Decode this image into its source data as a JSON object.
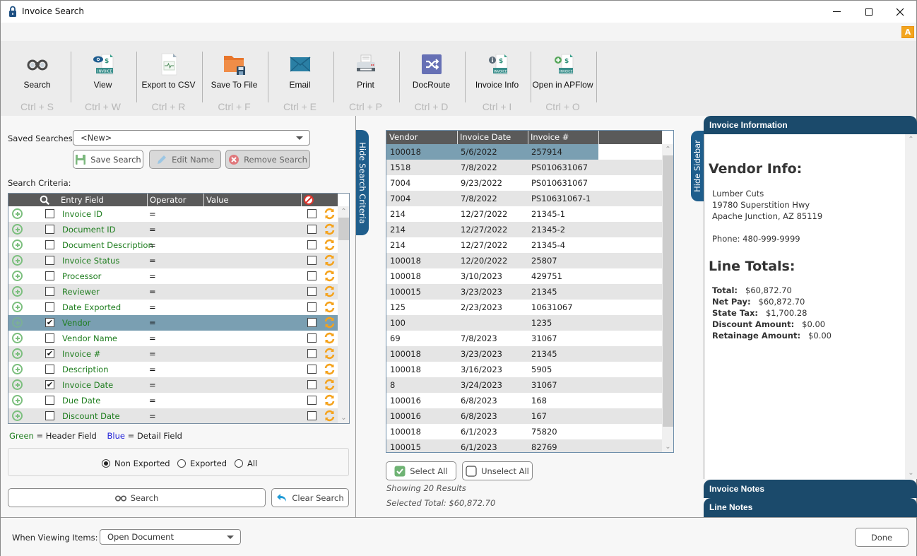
{
  "window": {
    "title": "Invoice Search",
    "badge_letter": "A"
  },
  "toolbar": {
    "buttons": [
      {
        "id": "search",
        "label": "Search",
        "shortcut": "Ctrl + S",
        "icon": "binoculars-icon"
      },
      {
        "id": "view",
        "label": "View",
        "shortcut": "Ctrl + W",
        "icon": "view-invoice-icon"
      },
      {
        "id": "export",
        "label": "Export to CSV",
        "shortcut": "Ctrl + R",
        "icon": "csv-file-icon"
      },
      {
        "id": "save",
        "label": "Save To File",
        "shortcut": "Ctrl + F",
        "icon": "folder-save-icon"
      },
      {
        "id": "email",
        "label": "Email",
        "shortcut": "Ctrl + E",
        "icon": "envelope-icon"
      },
      {
        "id": "print",
        "label": "Print",
        "shortcut": "Ctrl + P",
        "icon": "printer-icon"
      },
      {
        "id": "docroute",
        "label": "DocRoute",
        "shortcut": "Ctrl + D",
        "icon": "shuffle-icon"
      },
      {
        "id": "invoiceinfo",
        "label": "Invoice Info",
        "shortcut": "Ctrl + I",
        "icon": "invoice-info-icon"
      },
      {
        "id": "apflow",
        "label": "Open in APFlow",
        "shortcut": "Ctrl + O",
        "icon": "invoice-add-icon"
      }
    ]
  },
  "search_panel": {
    "saved_searches_label": "Saved Searches:",
    "saved_searches_value": "<New>",
    "save_search_label": "Save Search",
    "edit_name_label": "Edit Name",
    "remove_search_label": "Remove Search",
    "criteria_label": "Search Criteria:",
    "columns": {
      "entry_field": "Entry Field",
      "operator": "Operator",
      "value": "Value"
    },
    "criteria": [
      {
        "field": "Invoice ID",
        "checked": false,
        "operator": "=",
        "value": "",
        "exclude": false
      },
      {
        "field": "Document ID",
        "checked": false,
        "operator": "=",
        "value": "",
        "exclude": false
      },
      {
        "field": "Document Description",
        "checked": false,
        "operator": "=",
        "value": "",
        "exclude": false
      },
      {
        "field": "Invoice Status",
        "checked": false,
        "operator": "=",
        "value": "",
        "exclude": false
      },
      {
        "field": "Processor",
        "checked": false,
        "operator": "=",
        "value": "",
        "exclude": false
      },
      {
        "field": "Reviewer",
        "checked": false,
        "operator": "=",
        "value": "",
        "exclude": false
      },
      {
        "field": "Date Exported",
        "checked": false,
        "operator": "=",
        "value": "",
        "exclude": false
      },
      {
        "field": "Vendor",
        "checked": true,
        "operator": "=",
        "value": "",
        "exclude": false,
        "selected": true
      },
      {
        "field": "Vendor Name",
        "checked": false,
        "operator": "=",
        "value": "",
        "exclude": false
      },
      {
        "field": "Invoice #",
        "checked": true,
        "operator": "=",
        "value": "",
        "exclude": false
      },
      {
        "field": "Description",
        "checked": false,
        "operator": "=",
        "value": "",
        "exclude": false
      },
      {
        "field": "Invoice Date",
        "checked": true,
        "operator": "=",
        "value": "",
        "exclude": false
      },
      {
        "field": "Due Date",
        "checked": false,
        "operator": "=",
        "value": "",
        "exclude": false
      },
      {
        "field": "Discount Date",
        "checked": false,
        "operator": "=",
        "value": "",
        "exclude": false
      }
    ],
    "legend": {
      "green_word": "Green",
      "green_text": " = Header Field",
      "blue_word": "Blue",
      "blue_text": " = Detail Field"
    },
    "colors": {
      "header_field": "#1e7d1e",
      "detail_field": "#2424d8"
    },
    "export_filter": {
      "options": [
        "Non Exported",
        "Exported",
        "All"
      ],
      "selected": "Non Exported"
    },
    "search_button": "Search",
    "clear_search_button": "Clear Search",
    "hide_tab": "Hide Search Criteria"
  },
  "results": {
    "columns": [
      "Vendor",
      "Invoice Date",
      "Invoice #"
    ],
    "rows": [
      {
        "vendor": "100018",
        "date": "5/6/2022",
        "invoice": "257914",
        "selected": true
      },
      {
        "vendor": "1518",
        "date": "7/8/2022",
        "invoice": "PS010631067"
      },
      {
        "vendor": "7004",
        "date": "9/23/2022",
        "invoice": "PS010631067"
      },
      {
        "vendor": "7004",
        "date": "7/8/2022",
        "invoice": "PS10631067-1"
      },
      {
        "vendor": "214",
        "date": "12/27/2022",
        "invoice": "21345-1"
      },
      {
        "vendor": "214",
        "date": "12/27/2022",
        "invoice": "21345-2"
      },
      {
        "vendor": "214",
        "date": "12/27/2022",
        "invoice": "21345-4"
      },
      {
        "vendor": "100018",
        "date": "12/20/2022",
        "invoice": "25807"
      },
      {
        "vendor": "100018",
        "date": "3/10/2023",
        "invoice": "429751"
      },
      {
        "vendor": "100015",
        "date": "3/23/2023",
        "invoice": "21345"
      },
      {
        "vendor": "125",
        "date": "2/23/2023",
        "invoice": "10631067"
      },
      {
        "vendor": "100",
        "date": "",
        "invoice": "1235"
      },
      {
        "vendor": "69",
        "date": "7/8/2023",
        "invoice": "31067"
      },
      {
        "vendor": "100018",
        "date": "3/23/2023",
        "invoice": "21345"
      },
      {
        "vendor": "100018",
        "date": "3/16/2023",
        "invoice": "5905"
      },
      {
        "vendor": "8",
        "date": "3/24/2023",
        "invoice": "31067"
      },
      {
        "vendor": "100016",
        "date": "6/8/2023",
        "invoice": "168"
      },
      {
        "vendor": "100016",
        "date": "6/8/2023",
        "invoice": "167"
      },
      {
        "vendor": "100018",
        "date": "6/1/2023",
        "invoice": "75820"
      },
      {
        "vendor": "100015",
        "date": "6/1/2023",
        "invoice": "82769"
      }
    ],
    "select_all": "Select All",
    "unselect_all": "Unselect All",
    "showing": "Showing 20 Results",
    "selected_total": "Selected Total: $60,872.70"
  },
  "sidebar": {
    "hide_tab": "Hide Sidebar",
    "header": "Invoice Information",
    "vendor_heading": "Vendor Info:",
    "vendor_name": "Lumber Cuts",
    "vendor_address1": "19780 Superstition Hwy",
    "vendor_address2": "Apache Junction, AZ 85119",
    "vendor_phone": "Phone: 480-999-9999",
    "totals_heading": "Line Totals:",
    "totals": [
      {
        "label": "Total:",
        "value": "$60,872.70"
      },
      {
        "label": "Net Pay:",
        "value": "$60,872.70"
      },
      {
        "label": "State Tax:",
        "value": "$1,700.28"
      },
      {
        "label": "Discount Amount:",
        "value": "$0.00"
      },
      {
        "label": "Retainage Amount:",
        "value": "$0.00"
      }
    ],
    "invoice_notes": "Invoice Notes",
    "line_notes": "Line Notes"
  },
  "footer": {
    "viewing_label": "When Viewing Items:",
    "viewing_value": "Open Document",
    "done": "Done"
  }
}
